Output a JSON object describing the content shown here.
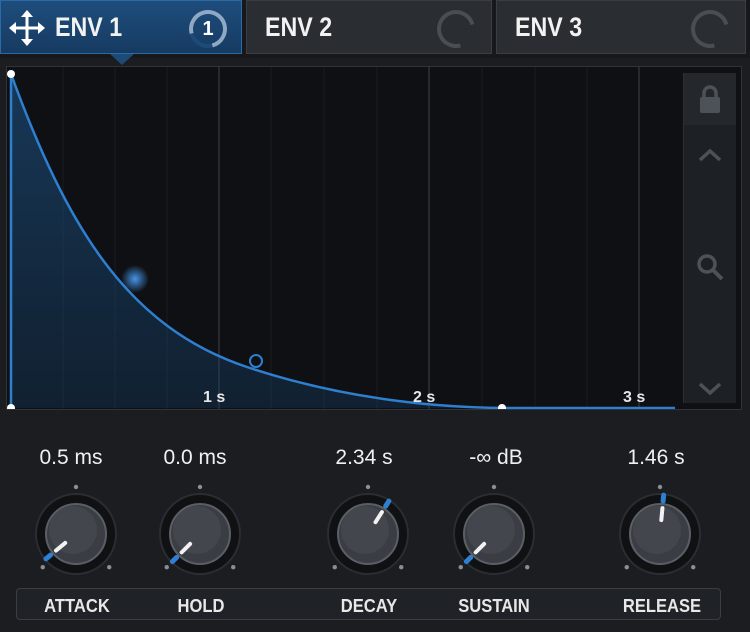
{
  "tabs": [
    {
      "label": "ENV 1",
      "active": true,
      "badge": "1"
    },
    {
      "label": "ENV 2",
      "active": false
    },
    {
      "label": "ENV 3",
      "active": false
    }
  ],
  "graph": {
    "time_labels": [
      "1 s",
      "2 s",
      "3 s"
    ],
    "sidebar": {
      "lock": "lock-icon",
      "up": "chevron-up-icon",
      "zoom": "magnifier-icon",
      "down": "chevron-down-icon"
    },
    "accent": "#2f7fd1"
  },
  "knobs": [
    {
      "id": "attack",
      "label": "ATTACK",
      "value": "0.5 ms",
      "level": 0.02
    },
    {
      "id": "hold",
      "label": "HOLD",
      "value": "0.0 ms",
      "level": 0.0
    },
    {
      "id": "decay",
      "label": "DECAY",
      "value": "2.34 s",
      "level": 0.62
    },
    {
      "id": "sustain",
      "label": "SUSTAIN",
      "value": "-∞ dB",
      "level": 0.0
    },
    {
      "id": "release",
      "label": "RELEASE",
      "value": "1.46 s",
      "level": 0.52
    }
  ]
}
